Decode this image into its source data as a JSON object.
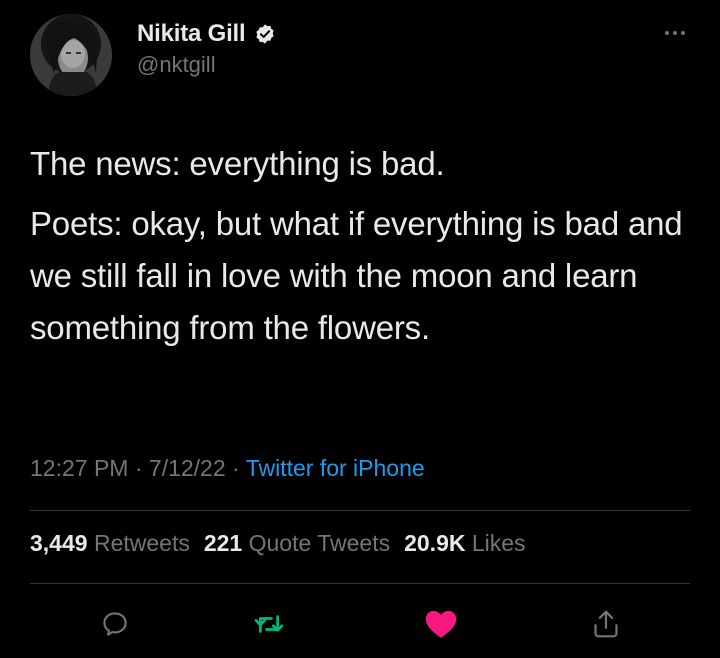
{
  "author": {
    "display_name": "Nikita Gill",
    "handle": "@nktgill",
    "verified": true
  },
  "tweet": {
    "paragraphs": [
      "The news: everything is bad.",
      "Poets: okay, but what if everything is bad and we still fall in love with the moon and learn something from the flowers."
    ],
    "time": "12:27 PM",
    "separator": "·",
    "date": "7/12/22",
    "source": "Twitter for iPhone"
  },
  "stats": {
    "retweets_count": "3,449",
    "retweets_label": "Retweets",
    "quotes_count": "221",
    "quotes_label": "Quote Tweets",
    "likes_count": "20.9K",
    "likes_label": "Likes"
  },
  "actions": {
    "reply_icon": "reply-icon",
    "retweet_icon": "retweet-icon",
    "like_icon": "heart-icon",
    "share_icon": "share-icon",
    "liked": true
  },
  "colors": {
    "background": "#000000",
    "text": "#e7e9ea",
    "secondary": "#71767b",
    "link": "#1d9bf0",
    "retweet": "#00ba7c",
    "like": "#f91880"
  }
}
